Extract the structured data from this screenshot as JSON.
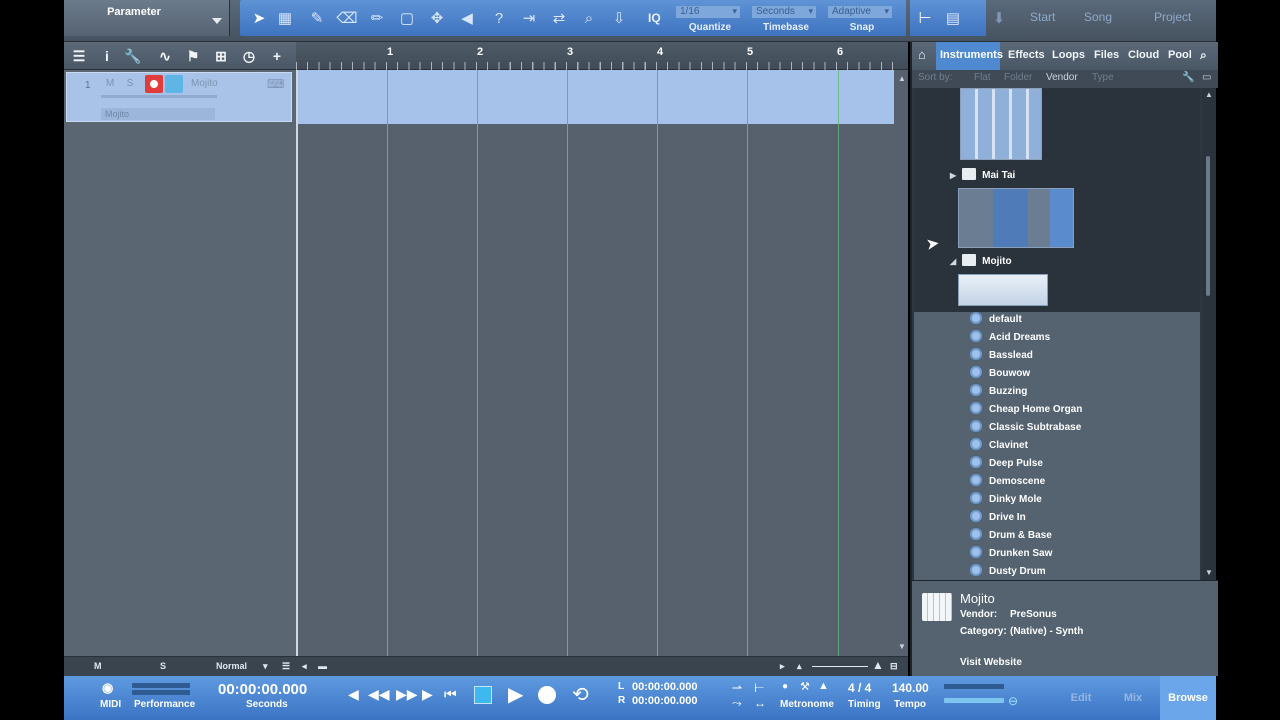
{
  "toolbar": {
    "parameter_label": "Parameter",
    "iq_label": "IQ",
    "quantize": {
      "value": "1/16",
      "label": "Quantize"
    },
    "timebase": {
      "value": "Seconds",
      "label": "Timebase"
    },
    "snap": {
      "value": "Adaptive",
      "label": "Snap"
    },
    "pages": [
      "Start",
      "Song",
      "Project"
    ]
  },
  "track": {
    "number": "1",
    "mute": "M",
    "solo": "S",
    "name": "Mojito",
    "instrument": "Mojito"
  },
  "ruler": {
    "bars": [
      "1",
      "2",
      "3",
      "4",
      "5",
      "6"
    ]
  },
  "track_footer": {
    "m": "M",
    "s": "S",
    "mode": "Normal"
  },
  "browser": {
    "tabs": [
      "Instruments",
      "Effects",
      "Loops",
      "Files",
      "Cloud",
      "Pool"
    ],
    "sort_by": "Sort by:",
    "sort_options": [
      "Flat",
      "Folder",
      "Vendor",
      "Type"
    ],
    "folders": [
      "Mai Tai",
      "Mojito"
    ],
    "presets": [
      "default",
      "Acid Dreams",
      "Basslead",
      "Bouwow",
      "Buzzing",
      "Cheap Home Organ",
      "Classic Subtrabase",
      "Clavinet",
      "Deep Pulse",
      "Demoscene",
      "Dinky Mole",
      "Drive In",
      "Drum & Base",
      "Drunken Saw",
      "Dusty Drum"
    ],
    "info": {
      "name": "Mojito",
      "vendor_label": "Vendor:",
      "vendor": "PreSonus",
      "category_label": "Category:",
      "category": "(Native) - Synth",
      "website": "Visit Website"
    }
  },
  "transport": {
    "midi_label": "MIDI",
    "performance_label": "Performance",
    "time": "00:00:00.000",
    "time_label": "Seconds",
    "loop_l_label": "L",
    "loop_l": "00:00:00.000",
    "loop_r_label": "R",
    "loop_r": "00:00:00.000",
    "metronome_label": "Metronome",
    "timing_value": "4 / 4",
    "timing_label": "Timing",
    "tempo_value": "140.00",
    "tempo_label": "Tempo",
    "views": [
      "Edit",
      "Mix",
      "Browse"
    ]
  }
}
